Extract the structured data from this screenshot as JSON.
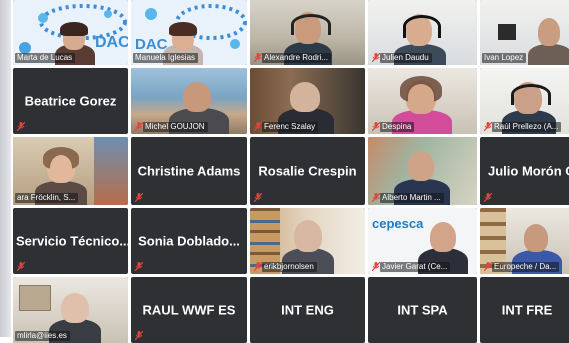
{
  "participants": [
    {
      "label": "Marta de Lucas",
      "logo_text": "DAC",
      "mic_muted": false
    },
    {
      "label": "Manuela Iglesias",
      "logo_text": "DAC",
      "mic_muted": false
    },
    {
      "label": "Alexandre Rodri...",
      "mic_muted": true
    },
    {
      "label": "Julien Daudu",
      "mic_muted": true
    },
    {
      "label": "Ivan Lopez",
      "mic_muted": false,
      "active_speaker": true
    },
    {
      "label": "Beatrice Gorez",
      "mic_muted": true
    },
    {
      "label": "Michel GOUJON",
      "mic_muted": true
    },
    {
      "label": "Ferenc Szalay",
      "mic_muted": true
    },
    {
      "label": "Despina",
      "mic_muted": true
    },
    {
      "label": "Raúl Prellezo (A...",
      "mic_muted": true
    },
    {
      "label": "ara Fröcklin, S...",
      "mic_muted": false
    },
    {
      "label": "Christine Adams",
      "mic_muted": true
    },
    {
      "label": "Rosalie Crespin",
      "mic_muted": true
    },
    {
      "label": "Alberto Martin ...",
      "mic_muted": true
    },
    {
      "label": "Julio Morón Ol",
      "mic_muted": true
    },
    {
      "label": "Servicio Técnico...",
      "mic_muted": true
    },
    {
      "label": "Sonia Doblado...",
      "mic_muted": true
    },
    {
      "label": "erikbjornolsen",
      "mic_muted": true
    },
    {
      "label": "Javier Garat (Ce...",
      "logo_text": "cepesca",
      "mic_muted": true
    },
    {
      "label": "Europeche / Da...",
      "mic_muted": true
    },
    {
      "label": "mlirla@iies.es",
      "mic_muted": false
    },
    {
      "label": "RAUL WWF ES",
      "mic_muted": true
    },
    {
      "label": "INT ENG",
      "mic_muted": false
    },
    {
      "label": "INT SPA",
      "mic_muted": false
    },
    {
      "label": "INT FRE",
      "mic_muted": false
    }
  ],
  "colors": {
    "tile_bg": "#2f3034",
    "muted_icon": "#e0443c",
    "active_border": "#e7e23a",
    "name_text": "#ffffff"
  },
  "icons": {
    "muted": "mic-muted-icon"
  }
}
